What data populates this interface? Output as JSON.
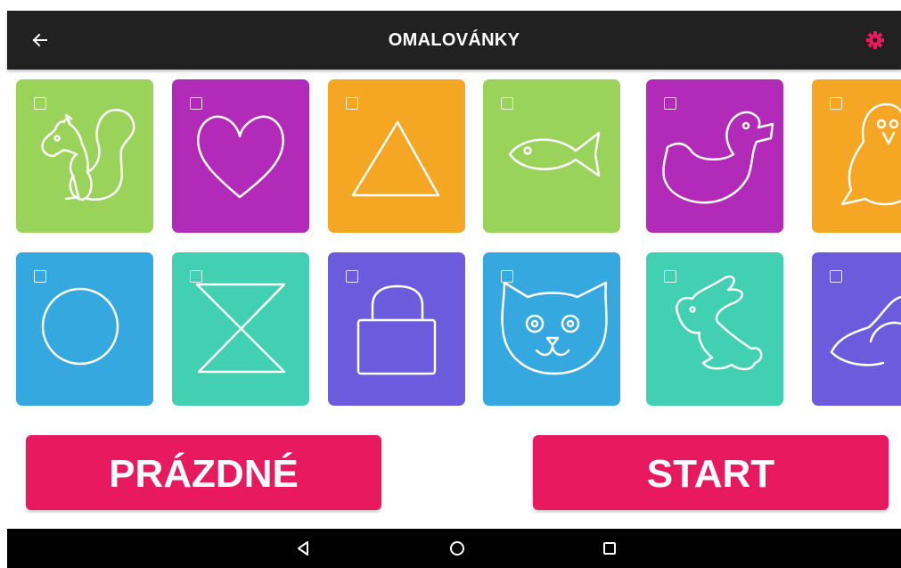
{
  "app": {
    "title": "OMALOVÁNKY",
    "accent_color": "#e9195f",
    "bar_color": "#212121"
  },
  "toolbar": {
    "back_icon": "arrow-left-icon",
    "settings_icon": "gear-icon"
  },
  "tiles": [
    {
      "name": "squirrel",
      "color": "#9ad35a",
      "checked": false
    },
    {
      "name": "heart",
      "color": "#b22bb8",
      "checked": false
    },
    {
      "name": "triangle",
      "color": "#f5a623",
      "checked": false
    },
    {
      "name": "fish",
      "color": "#9ad35a",
      "checked": false
    },
    {
      "name": "duck",
      "color": "#b22bb8",
      "checked": false
    },
    {
      "name": "penguin",
      "color": "#f5a623",
      "checked": false
    },
    {
      "name": "circle",
      "color": "#35a8e0",
      "checked": false
    },
    {
      "name": "hourglass",
      "color": "#41d0b2",
      "checked": false
    },
    {
      "name": "padlock",
      "color": "#6c5bdc",
      "checked": false
    },
    {
      "name": "cat",
      "color": "#35a8e0",
      "checked": false
    },
    {
      "name": "rabbit",
      "color": "#41d0b2",
      "checked": false
    },
    {
      "name": "bird",
      "color": "#6c5bdc",
      "checked": false
    }
  ],
  "buttons": {
    "empty_label": "PRÁZDNÉ",
    "start_label": "START"
  },
  "navbar": {
    "back_icon": "nav-back-icon",
    "home_icon": "nav-home-icon",
    "recents_icon": "nav-recents-icon"
  }
}
